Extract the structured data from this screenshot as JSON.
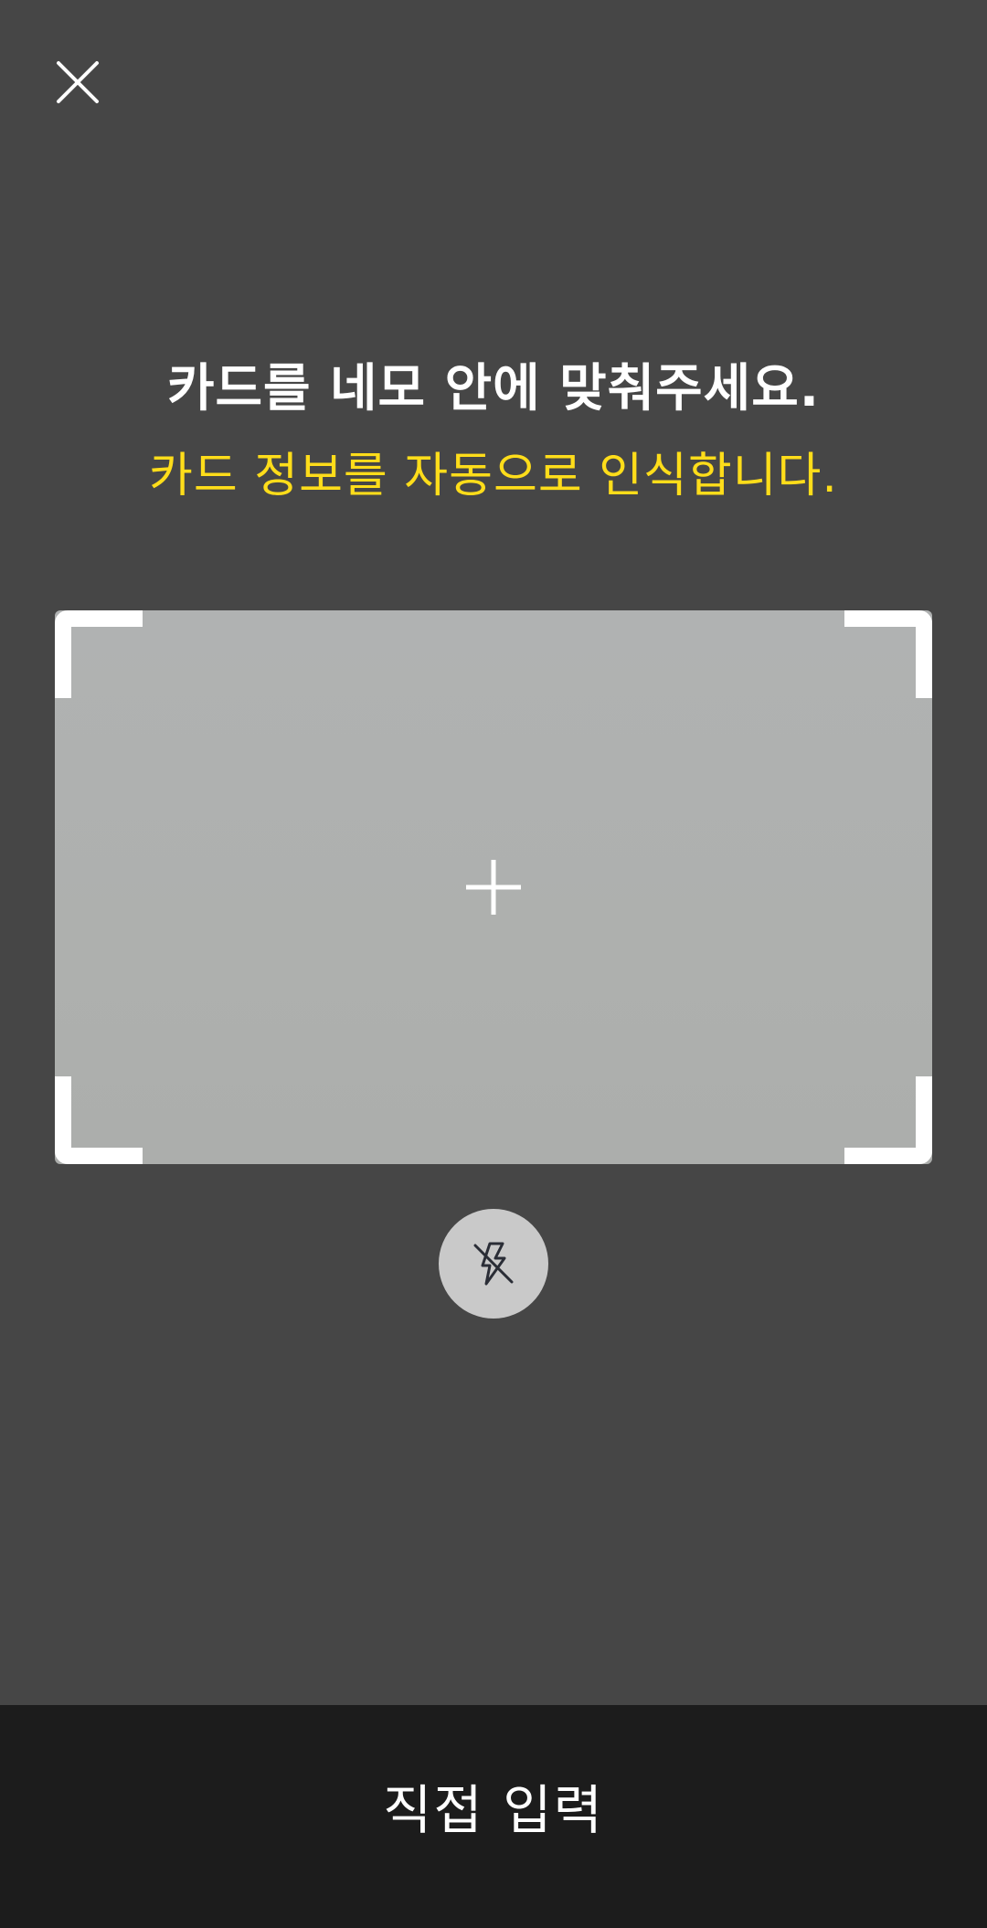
{
  "header": {
    "close_icon": "close-icon"
  },
  "instructions": {
    "title": "카드를 네모 안에 맞춰주세요.",
    "subtitle": "카드 정보를 자동으로 인식합니다."
  },
  "scanner": {
    "crosshair_icon": "plus-icon",
    "flash_icon": "flash-off-icon"
  },
  "footer": {
    "manual_entry_label": "직접 입력"
  },
  "colors": {
    "background": "#464646",
    "subtitle": "#ffdd1a",
    "footer": "#1c1c1c",
    "frame_corners": "#ffffff",
    "flash_button": "#c9c9c9"
  }
}
